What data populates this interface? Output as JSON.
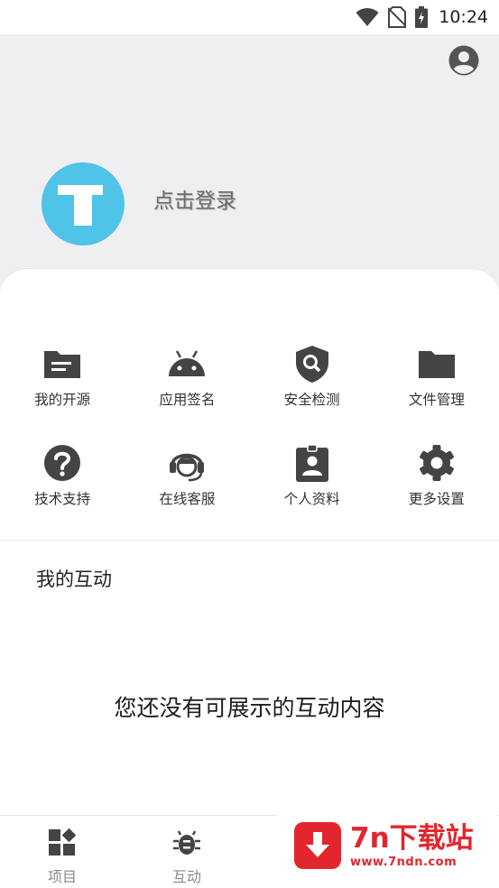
{
  "status_bar": {
    "time": "10:24"
  },
  "header": {
    "login_text": "点击登录",
    "background": "#efeff2",
    "logo_color": "#4fc3e8"
  },
  "features": [
    {
      "label": "我的开源",
      "icon": "folder-doc-icon"
    },
    {
      "label": "应用签名",
      "icon": "android-icon"
    },
    {
      "label": "安全检测",
      "icon": "shield-search-icon"
    },
    {
      "label": "文件管理",
      "icon": "folder-icon"
    },
    {
      "label": "技术支持",
      "icon": "help-icon"
    },
    {
      "label": "在线客服",
      "icon": "headset-icon"
    },
    {
      "label": "个人资料",
      "icon": "id-badge-icon"
    },
    {
      "label": "更多设置",
      "icon": "gear-icon"
    }
  ],
  "interactions": {
    "title": "我的互动",
    "empty_message": "您还没有可展示的互动内容"
  },
  "bottom_nav": [
    {
      "label": "项目",
      "icon": "dashboard-icon"
    },
    {
      "label": "互动",
      "icon": "bug-icon"
    }
  ],
  "watermark": {
    "title": "7n下载站",
    "url": "www.7ndn.com",
    "color": "#e3262e"
  },
  "colors": {
    "icon": "#444444",
    "accent": "#4fc3e8"
  }
}
